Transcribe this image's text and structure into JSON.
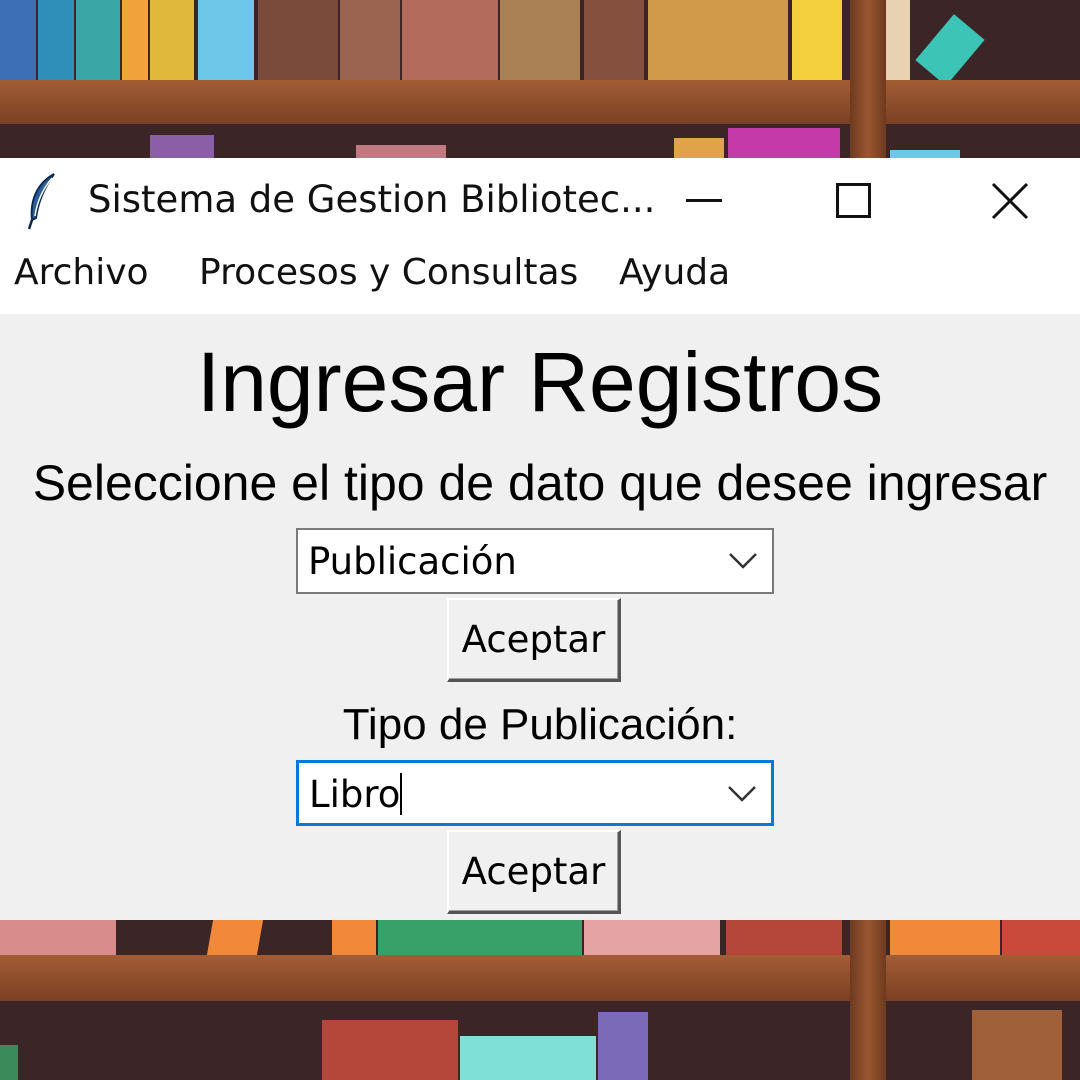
{
  "window": {
    "title": "Sistema de Gestion Bibliotec..."
  },
  "menubar": {
    "items": [
      "Archivo",
      "Procesos y Consultas",
      "Ayuda"
    ]
  },
  "main": {
    "heading": "Ingresar Registros",
    "instruction": "Seleccione el tipo de dato que desee ingresar",
    "data_type_select": {
      "value": "Publicación"
    },
    "accept_button_1": "Aceptar",
    "publication_type_label": "Tipo de Publicación:",
    "publication_type_select": {
      "value": "Libro"
    },
    "accept_button_2": "Aceptar"
  },
  "colors": {
    "focus_border": "#0a78d7",
    "background_panel": "#f0f0f0",
    "shelf_wood": "#8a4b2c"
  }
}
